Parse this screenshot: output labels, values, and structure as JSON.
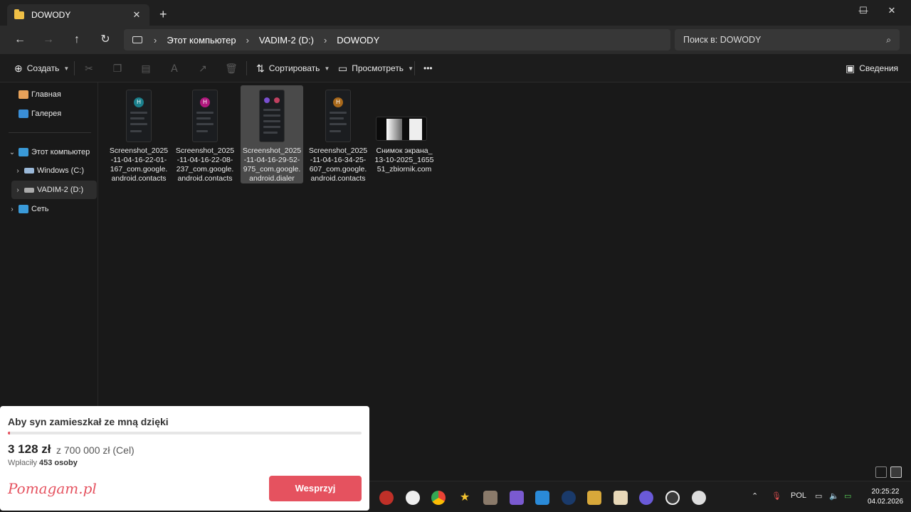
{
  "window": {
    "tab_title": "DOWODY",
    "tab_close": "✕",
    "new_tab": "+",
    "controls": [
      "—",
      "☐",
      "✕"
    ]
  },
  "nav": {
    "back": "←",
    "forward": "→",
    "up": "↑",
    "refresh": "↻",
    "breadcrumbs": [
      "Этот компьютер",
      "VADIM-2 (D:)",
      "DOWODY"
    ],
    "search_placeholder": "Поиск в: DOWODY"
  },
  "command_bar": {
    "create": "Создать",
    "sort": "Сортировать",
    "view": "Просмотреть",
    "more": "•••",
    "details": "Сведения"
  },
  "sidebar": {
    "items": [
      {
        "label": "Главная",
        "icon": "home-icon",
        "color": "#e8a25a"
      },
      {
        "label": "Галерея",
        "icon": "gallery-icon",
        "color": "#3a8fd8"
      },
      {
        "label": "Этот компьютер",
        "icon": "computer-icon",
        "color": "#3a9ad8"
      },
      {
        "label": "Windows (C:)",
        "icon": "drive-icon",
        "color": "#9ab8d8"
      },
      {
        "label": "VADIM-2 (D:)",
        "icon": "drive-icon",
        "color": "#aaaaaa"
      },
      {
        "label": "Сеть",
        "icon": "network-icon",
        "color": "#3a9ad8"
      }
    ]
  },
  "files": [
    {
      "name": "Screenshot_2025-11-04-16-22-01-167_com.google.android.contacts",
      "avatar": "H",
      "avatar_color": "#1a7f8c"
    },
    {
      "name": "Screenshot_2025-11-04-16-22-08-237_com.google.android.contacts",
      "avatar": "H",
      "avatar_color": "#b0187e"
    },
    {
      "name": "Screenshot_2025-11-04-16-29-52-975_com.google.android.dialer",
      "avatar": "",
      "avatar_color": "#7a4fd0"
    },
    {
      "name": "Screenshot_2025-11-04-16-34-25-607_com.google.android.contacts",
      "avatar": "H",
      "avatar_color": "#a8681a"
    },
    {
      "name": "Снимок экрана_13-10-2025_165551_zbiornik.com",
      "avatar": "",
      "avatar_color": ""
    }
  ],
  "taskbar": {
    "language": "POL",
    "time": "20:25:22",
    "date": "04.02.2026"
  },
  "popup": {
    "title": "Aby syn zamieszkał ze mną dzięki",
    "progress": 0.0045,
    "amount": "3 128 zł",
    "goal": "z 700 000 zł (Cel)",
    "donors_label": "Wpłaciły",
    "donors_count": "453 osoby",
    "logo": "Pomagam.pl",
    "button": "Wesprzyj",
    "accent": "#e5525f"
  }
}
